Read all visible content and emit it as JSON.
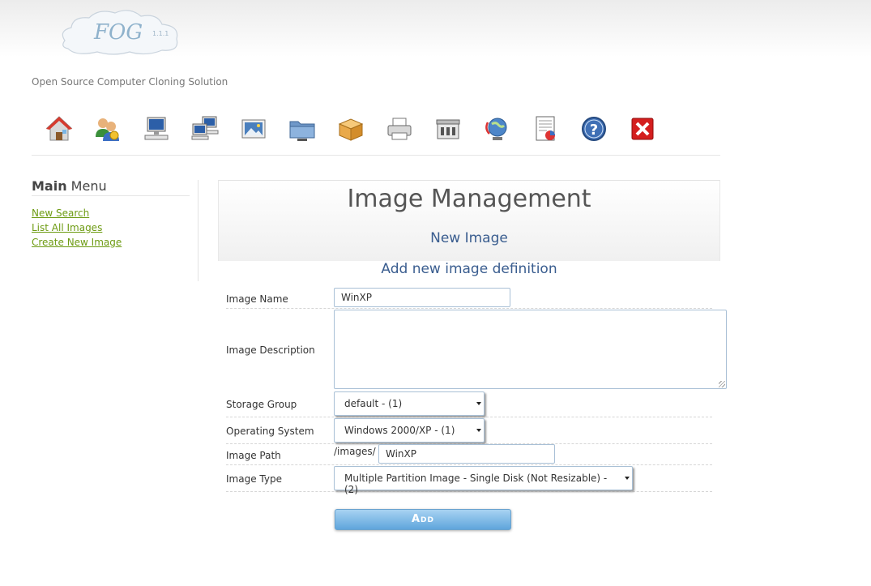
{
  "header": {
    "logo_text": "FOG",
    "version": "1.1.1",
    "tagline": "Open Source Computer Cloning Solution"
  },
  "nav_icons": [
    {
      "name": "home-icon"
    },
    {
      "name": "users-icon"
    },
    {
      "name": "host-icon"
    },
    {
      "name": "groups-icon"
    },
    {
      "name": "images-icon"
    },
    {
      "name": "storage-icon"
    },
    {
      "name": "snapins-icon"
    },
    {
      "name": "printers-icon"
    },
    {
      "name": "services-icon"
    },
    {
      "name": "tasks-icon"
    },
    {
      "name": "reports-icon"
    },
    {
      "name": "help-icon"
    },
    {
      "name": "logout-icon"
    }
  ],
  "sidebar": {
    "title_bold": "Main",
    "title_rest": " Menu",
    "links": [
      "New Search",
      "List All Images",
      "Create New Image"
    ]
  },
  "main": {
    "title": "Image Management",
    "subtitle": "New Image",
    "form_title": "Add new image definition"
  },
  "form": {
    "image_name_label": "Image Name",
    "image_name_value": "WinXP",
    "description_label": "Image Description",
    "description_value": "",
    "storage_group_label": "Storage Group",
    "storage_group_value": "default - (1)",
    "os_label": "Operating System",
    "os_value": "Windows 2000/XP - (1)",
    "path_label": "Image Path",
    "path_prefix": "/images/",
    "path_value": "WinXP",
    "type_label": "Image Type",
    "type_value": "Multiple Partition Image - Single Disk (Not Resizable) - (2)",
    "submit_label": "Add"
  },
  "colors": {
    "link": "#6d9b12",
    "heading_blue": "#3a5d8f",
    "button": "#5fa5dc"
  }
}
